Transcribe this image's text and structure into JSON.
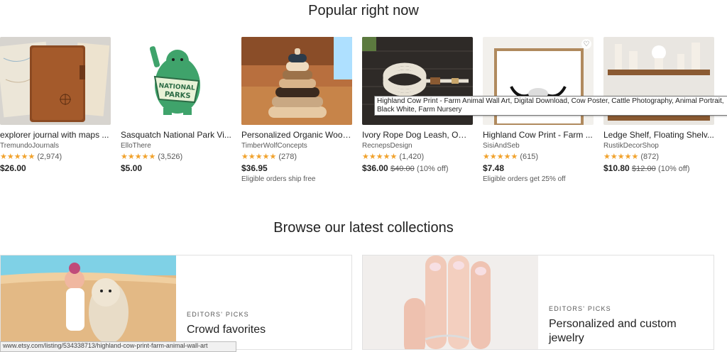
{
  "popular": {
    "title": "Popular right now",
    "items": [
      {
        "title": "explorer journal with maps ...",
        "shop": "TremundoJournals",
        "stars": "★★★★★",
        "reviews": "(2,974)",
        "price": "$26.00",
        "orig": "",
        "off": "",
        "note": "",
        "image_icon": "leather-journal-image"
      },
      {
        "title": "Sasquatch National Park Vi...",
        "shop": "ElloThere",
        "stars": "★★★★★",
        "reviews": "(3,526)",
        "price": "$5.00",
        "orig": "",
        "off": "",
        "note": "",
        "image_icon": "sasquatch-sticker-image"
      },
      {
        "title": "Personalized Organic Wood...",
        "shop": "TimberWolfConcepts",
        "stars": "★★★★★",
        "reviews": "(278)",
        "price": "$36.95",
        "orig": "",
        "off": "",
        "note": "Eligible orders ship free",
        "image_icon": "wooden-stacker-image"
      },
      {
        "title": "Ivory Rope Dog Leash, Omb...",
        "shop": "RecnepsDesign",
        "stars": "★★★★★",
        "reviews": "(1,420)",
        "price": "$36.00",
        "orig": "$40.00",
        "off": "(10% off)",
        "note": "",
        "image_icon": "rope-leash-image"
      },
      {
        "title": "Highland Cow Print - Farm ...",
        "shop": "SisiAndSeb",
        "stars": "★★★★★",
        "reviews": "(615)",
        "price": "$7.48",
        "orig": "",
        "off": "",
        "note": "Eligible orders get 25% off",
        "image_icon": "cow-print-image"
      },
      {
        "title": "Ledge Shelf, Floating Shelv...",
        "shop": "RustikDecorShop",
        "stars": "★★★★★",
        "reviews": "(872)",
        "price": "$10.80",
        "orig": "$12.00",
        "off": "(10% off)",
        "note": "",
        "image_icon": "floating-shelf-image"
      }
    ]
  },
  "tooltip": {
    "text": "Highland Cow Print -  Farm Animal Wall Art, Digital Download, Cow Poster, Cattle Photography, Animal Portrait, Black White, Farm Nursery"
  },
  "collections": {
    "title": "Browse our latest collections",
    "items": [
      {
        "eyebrow": "EDITORS' PICKS",
        "title": "Crowd favorites",
        "image_icon": "girl-with-alpaca-image"
      },
      {
        "eyebrow": "EDITORS' PICKS",
        "title": "Personalized and custom jewelry",
        "image_icon": "hand-with-ring-image"
      }
    ]
  },
  "statusbar": {
    "url": "www.etsy.com/listing/534338713/highland-cow-print-farm-animal-wall-art"
  },
  "colors": {
    "star": "#f1a22c",
    "text": "#222222",
    "muted": "#595959"
  }
}
